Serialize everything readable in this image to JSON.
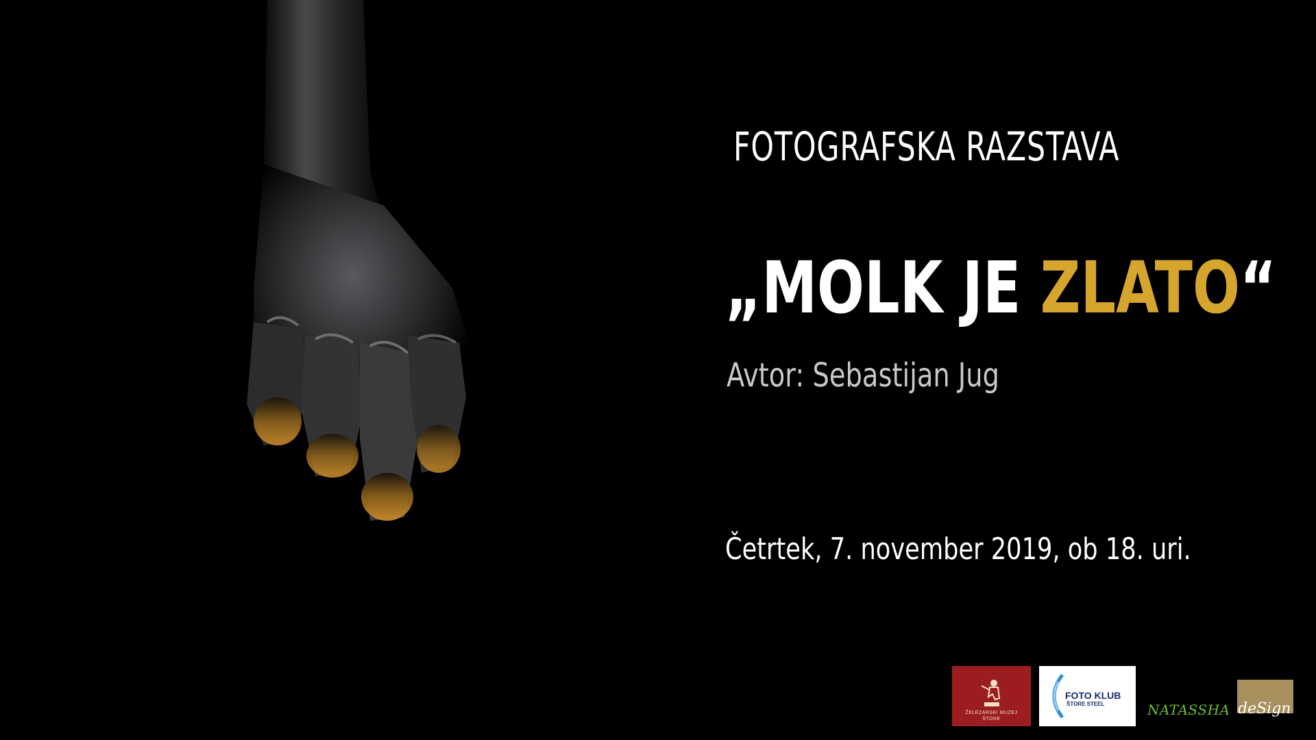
{
  "poster": {
    "subtitle": "FOTOGRAFSKA RAZSTAVA",
    "title_prefix": "„MOLK JE ",
    "title_gold": "ZLATO",
    "title_suffix": "“",
    "author": "Avtor: Sebastijan Jug",
    "date": "Četrtek, 7. november 2019, ob 18. uri.",
    "accent_color": "#d6a52e"
  },
  "logos": {
    "museum": {
      "text_line1": "ŽELEZARSKI MUZEJ",
      "text_line2": "ŠTORE"
    },
    "foto_klub": {
      "title": "FOTO KLUB",
      "sub": "ŠTORE STEEL"
    },
    "natassha": {
      "left": "NATASSHA",
      "right": "deSign"
    }
  }
}
